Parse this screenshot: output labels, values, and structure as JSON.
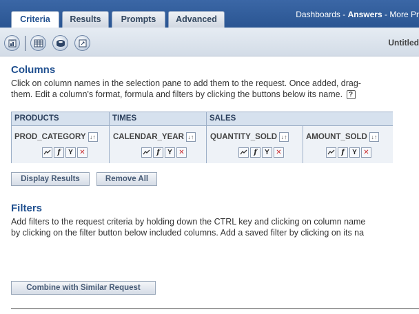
{
  "tabs": [
    {
      "label": "Criteria",
      "active": true
    },
    {
      "label": "Results",
      "active": false
    },
    {
      "label": "Prompts",
      "active": false
    },
    {
      "label": "Advanced",
      "active": false
    }
  ],
  "nav": {
    "dashboards": "Dashboards",
    "sep1": " - ",
    "answers": "Answers",
    "sep2": " - ",
    "more": "More Pr"
  },
  "toolbar": {
    "icons": [
      "report-icon",
      "table-view-icon",
      "disk-save-icon",
      "refresh-icon"
    ],
    "doc_title": "Untitled"
  },
  "columns_section": {
    "heading": "Columns",
    "line1": "Click on column names in the selection pane to add them to the request. Once added, drag-",
    "line2": "them. Edit a column's format, formula and filters by clicking the buttons below its name.",
    "help": "?"
  },
  "criteria": {
    "groups": [
      "PRODUCTS",
      "TIMES",
      "SALES"
    ],
    "columns": [
      "PROD_CATEGORY",
      "CALENDAR_YEAR",
      "QUANTITY_SOLD",
      "AMOUNT_SOLD"
    ],
    "sort_glyph": "↓↑",
    "col_buttons": {
      "format": "format-icon",
      "formula": "f",
      "filter": "Y",
      "delete": "✕"
    }
  },
  "actions": {
    "display_results": "Display Results",
    "remove_all": "Remove All"
  },
  "filters_section": {
    "heading": "Filters",
    "line1": "Add filters to the request criteria by holding down the CTRL key and clicking on column name",
    "line2": "by clicking on the filter button below included columns. Add a saved filter by clicking on its na"
  },
  "combine": "Combine with Similar Request",
  "colors": {
    "topbar": "#2f5a98",
    "heading": "#1f4f8f",
    "delete": "#c8282b"
  }
}
